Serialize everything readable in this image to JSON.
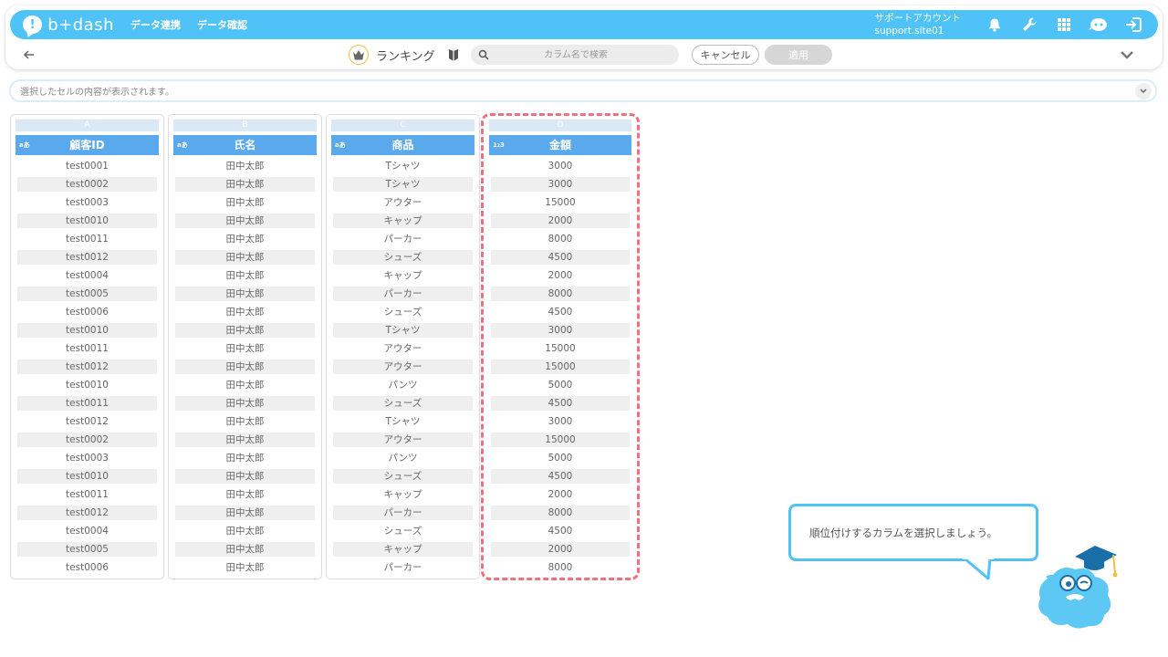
{
  "header": {
    "logo_text": "b+dash",
    "nav": [
      "データ連携",
      "データ確認"
    ],
    "account_label": "サポートアカウント",
    "account_id": "support.site01"
  },
  "toolbar": {
    "title": "ランキング",
    "search_placeholder": "カラム名で検索",
    "cancel_label": "キャンセル",
    "apply_label": "適用"
  },
  "cellbar": {
    "placeholder": "選択したセルの内容が表示されます。"
  },
  "columns": [
    {
      "letter": "A",
      "type_icon": "aあ",
      "name": "顧客ID",
      "cells": [
        "test0001",
        "test0002",
        "test0003",
        "test0010",
        "test0011",
        "test0012",
        "test0004",
        "test0005",
        "test0006",
        "test0010",
        "test0011",
        "test0012",
        "test0010",
        "test0011",
        "test0012",
        "test0002",
        "test0003",
        "test0010",
        "test0011",
        "test0012",
        "test0004",
        "test0005",
        "test0006"
      ]
    },
    {
      "letter": "B",
      "type_icon": "aあ",
      "name": "氏名",
      "cells": [
        "田中太郎",
        "田中太郎",
        "田中太郎",
        "田中太郎",
        "田中太郎",
        "田中太郎",
        "田中太郎",
        "田中太郎",
        "田中太郎",
        "田中太郎",
        "田中太郎",
        "田中太郎",
        "田中太郎",
        "田中太郎",
        "田中太郎",
        "田中太郎",
        "田中太郎",
        "田中太郎",
        "田中太郎",
        "田中太郎",
        "田中太郎",
        "田中太郎",
        "田中太郎"
      ]
    },
    {
      "letter": "C",
      "type_icon": "aあ",
      "name": "商品",
      "cells": [
        "Tシャツ",
        "Tシャツ",
        "アウター",
        "キャップ",
        "パーカー",
        "シューズ",
        "キャップ",
        "パーカー",
        "シューズ",
        "Tシャツ",
        "アウター",
        "アウター",
        "パンツ",
        "シューズ",
        "Tシャツ",
        "アウター",
        "パンツ",
        "シューズ",
        "キャップ",
        "パーカー",
        "シューズ",
        "キャップ",
        "パーカー"
      ]
    },
    {
      "letter": "D",
      "type_icon": "1₂3",
      "name": "金額",
      "cells": [
        "3000",
        "3000",
        "15000",
        "2000",
        "8000",
        "4500",
        "2000",
        "8000",
        "4500",
        "3000",
        "15000",
        "15000",
        "5000",
        "4500",
        "3000",
        "15000",
        "5000",
        "4500",
        "2000",
        "8000",
        "4500",
        "2000",
        "8000"
      ]
    }
  ],
  "tooltip": {
    "message": "順位付けするカラムを選択しましょう。"
  },
  "colors": {
    "brand": "#4fc3f7",
    "header_blue": "#5aa9ec",
    "highlight": "#f07080"
  },
  "icons": [
    "bell-icon",
    "wrench-icon",
    "grid-icon",
    "robot-icon",
    "logout-icon",
    "back-arrow-icon",
    "crown-icon",
    "bookmark-icon",
    "search-icon",
    "chevron-down-icon"
  ]
}
